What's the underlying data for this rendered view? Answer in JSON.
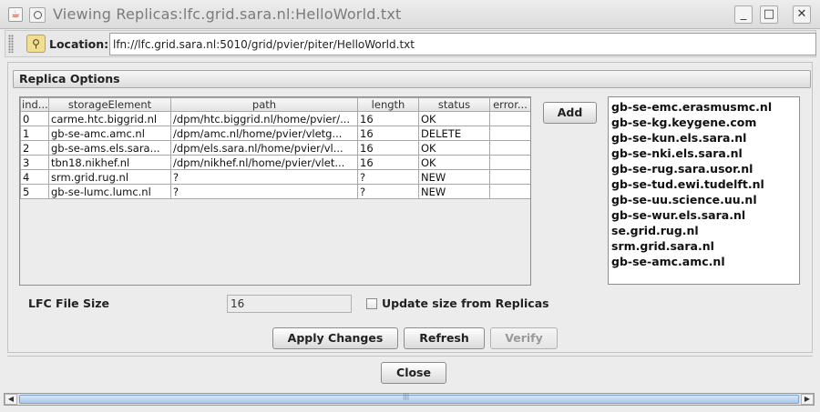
{
  "window": {
    "title": "Viewing Replicas:lfc.grid.sara.nl:HelloWorld.txt",
    "buttons": [
      "_",
      "□",
      "✕"
    ]
  },
  "location": {
    "label": "Location:",
    "value": "lfn://lfc.grid.sara.nl:5010/grid/pvier/piter/HelloWorld.txt"
  },
  "section": {
    "title": "Replica Options"
  },
  "table": {
    "columns": [
      "ind...",
      "storageElement",
      "path",
      "length",
      "status",
      "error..."
    ],
    "rows": [
      [
        "0",
        "carme.htc.biggrid.nl",
        "/dpm/htc.biggrid.nl/home/pvier/...",
        "16",
        "OK",
        ""
      ],
      [
        "1",
        "gb-se-amc.amc.nl",
        "/dpm/amc.nl/home/pvier/vletg...",
        "16",
        "DELETE",
        ""
      ],
      [
        "2",
        "gb-se-ams.els.sara...",
        "/dpm/els.sara.nl/home/pvier/vl...",
        "16",
        "OK",
        ""
      ],
      [
        "3",
        "tbn18.nikhef.nl",
        "/dpm/nikhef.nl/home/pvier/vlet...",
        "16",
        "OK",
        ""
      ],
      [
        "4",
        "srm.grid.rug.nl",
        "?",
        "?",
        "NEW",
        ""
      ],
      [
        "5",
        "gb-se-lumc.lumc.nl",
        "?",
        "?",
        "NEW",
        ""
      ]
    ]
  },
  "add_button": "Add",
  "storage_elements": [
    "gb-se-emc.erasmusmc.nl",
    "gb-se-kg.keygene.com",
    "gb-se-kun.els.sara.nl",
    "gb-se-nki.els.sara.nl",
    "gb-se-rug.sara.usor.nl",
    "gb-se-tud.ewi.tudelft.nl",
    "gb-se-uu.science.uu.nl",
    "gb-se-wur.els.sara.nl",
    "se.grid.rug.nl",
    "srm.grid.sara.nl",
    "gb-se-amc.amc.nl"
  ],
  "file_size": {
    "label": "LFC File Size",
    "value": "16",
    "checkbox_label": "Update size from Replicas",
    "checked": false
  },
  "actions": {
    "apply": "Apply Changes",
    "refresh": "Refresh",
    "verify": "Verify",
    "close": "Close"
  },
  "colors": {
    "scroll_thumb": "#a9c7e8",
    "java_icon": "#c03a1a",
    "location_icon": "#f1de8e"
  }
}
